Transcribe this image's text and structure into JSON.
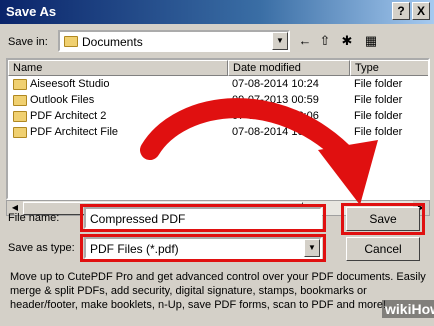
{
  "window": {
    "title": "Save As",
    "help_label": "?",
    "close_label": "X"
  },
  "location": {
    "label": "Save in:",
    "value": "Documents"
  },
  "columns": {
    "name": "Name",
    "date": "Date modified",
    "type": "Type"
  },
  "files": [
    {
      "name": "Aiseesoft Studio",
      "date": "07-08-2014 10:24",
      "type": "File folder"
    },
    {
      "name": "Outlook Files",
      "date": "09-07-2013 00:59",
      "type": "File folder"
    },
    {
      "name": "PDF Architect 2",
      "date": "07-08-2014 16:06",
      "type": "File folder"
    },
    {
      "name": "PDF Architect File",
      "date": "07-08-2014 10:06",
      "type": "File folder"
    }
  ],
  "form": {
    "filename_label": "File name:",
    "filename_value": "Compressed PDF",
    "type_label": "Save as type:",
    "type_value": "PDF Files (*.pdf)"
  },
  "buttons": {
    "save": "Save",
    "cancel": "Cancel"
  },
  "promo_text": "Move up to CutePDF Pro and get advanced control over your PDF documents. Easily merge & split PDFs, add security, digital signature, stamps, bookmarks or header/footer, make booklets, n-Up, save PDF forms, scan to PDF and more!",
  "watermark": "wikiHow",
  "colors": {
    "highlight": "#e01010",
    "titlebar": "#0a246a"
  }
}
